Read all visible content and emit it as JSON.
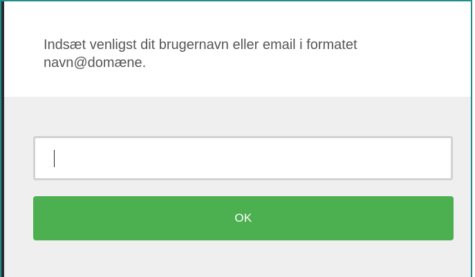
{
  "dialog": {
    "prompt": "Indsæt venligst dit brugernavn eller email i formatet navn@domæne.",
    "input": {
      "value": "",
      "placeholder": ""
    },
    "ok_label": "OK"
  },
  "colors": {
    "accent": "#4caf50",
    "frame_border": "#1f8c8f",
    "body_background": "#efefef",
    "prompt_text": "#555555"
  }
}
